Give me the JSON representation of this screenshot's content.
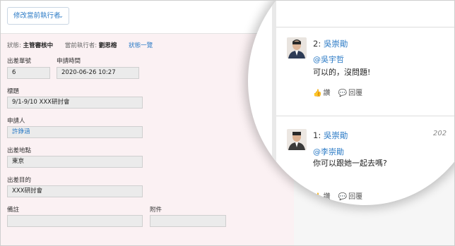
{
  "header": {
    "dropdown_label": "修改當前執行者",
    "icons": [
      "share-icon",
      "tag-icon",
      "gear-icon",
      "more-icon"
    ]
  },
  "status": {
    "status_label": "狀態:",
    "status_value": "主管審核中",
    "executor_label": "當前執行者:",
    "executor_value": "劉思榕",
    "history_link": "狀態一覽"
  },
  "form": {
    "trip_no_label": "出差單號",
    "trip_no_value": "6",
    "apply_time_label": "申請時間",
    "apply_time_value": "2020-06-26 10:27",
    "title_label": "標題",
    "title_value": "9/1-9/10 XXX研討會",
    "applicant_label": "申請人",
    "applicant_value": "許錚涵",
    "place_label": "出差地點",
    "place_value": "東京",
    "purpose_label": "出差目的",
    "purpose_value": "XXX研討會",
    "note_label": "備註",
    "note_value": "",
    "attachment_label": "附件",
    "attachment_value": ""
  },
  "comments": [
    {
      "index": "2:",
      "author": "吳崇勛",
      "time": "",
      "mention": "@吳宇哲",
      "text": "可以的，沒問題!",
      "like_label": "讚",
      "reply_label": "回覆"
    },
    {
      "index": "1:",
      "author": "吳崇勛",
      "time": "202",
      "mention": "@李崇勛",
      "text": "你可以跟她一起去嗎?",
      "like_label": "讚",
      "reply_label": "回覆"
    }
  ]
}
